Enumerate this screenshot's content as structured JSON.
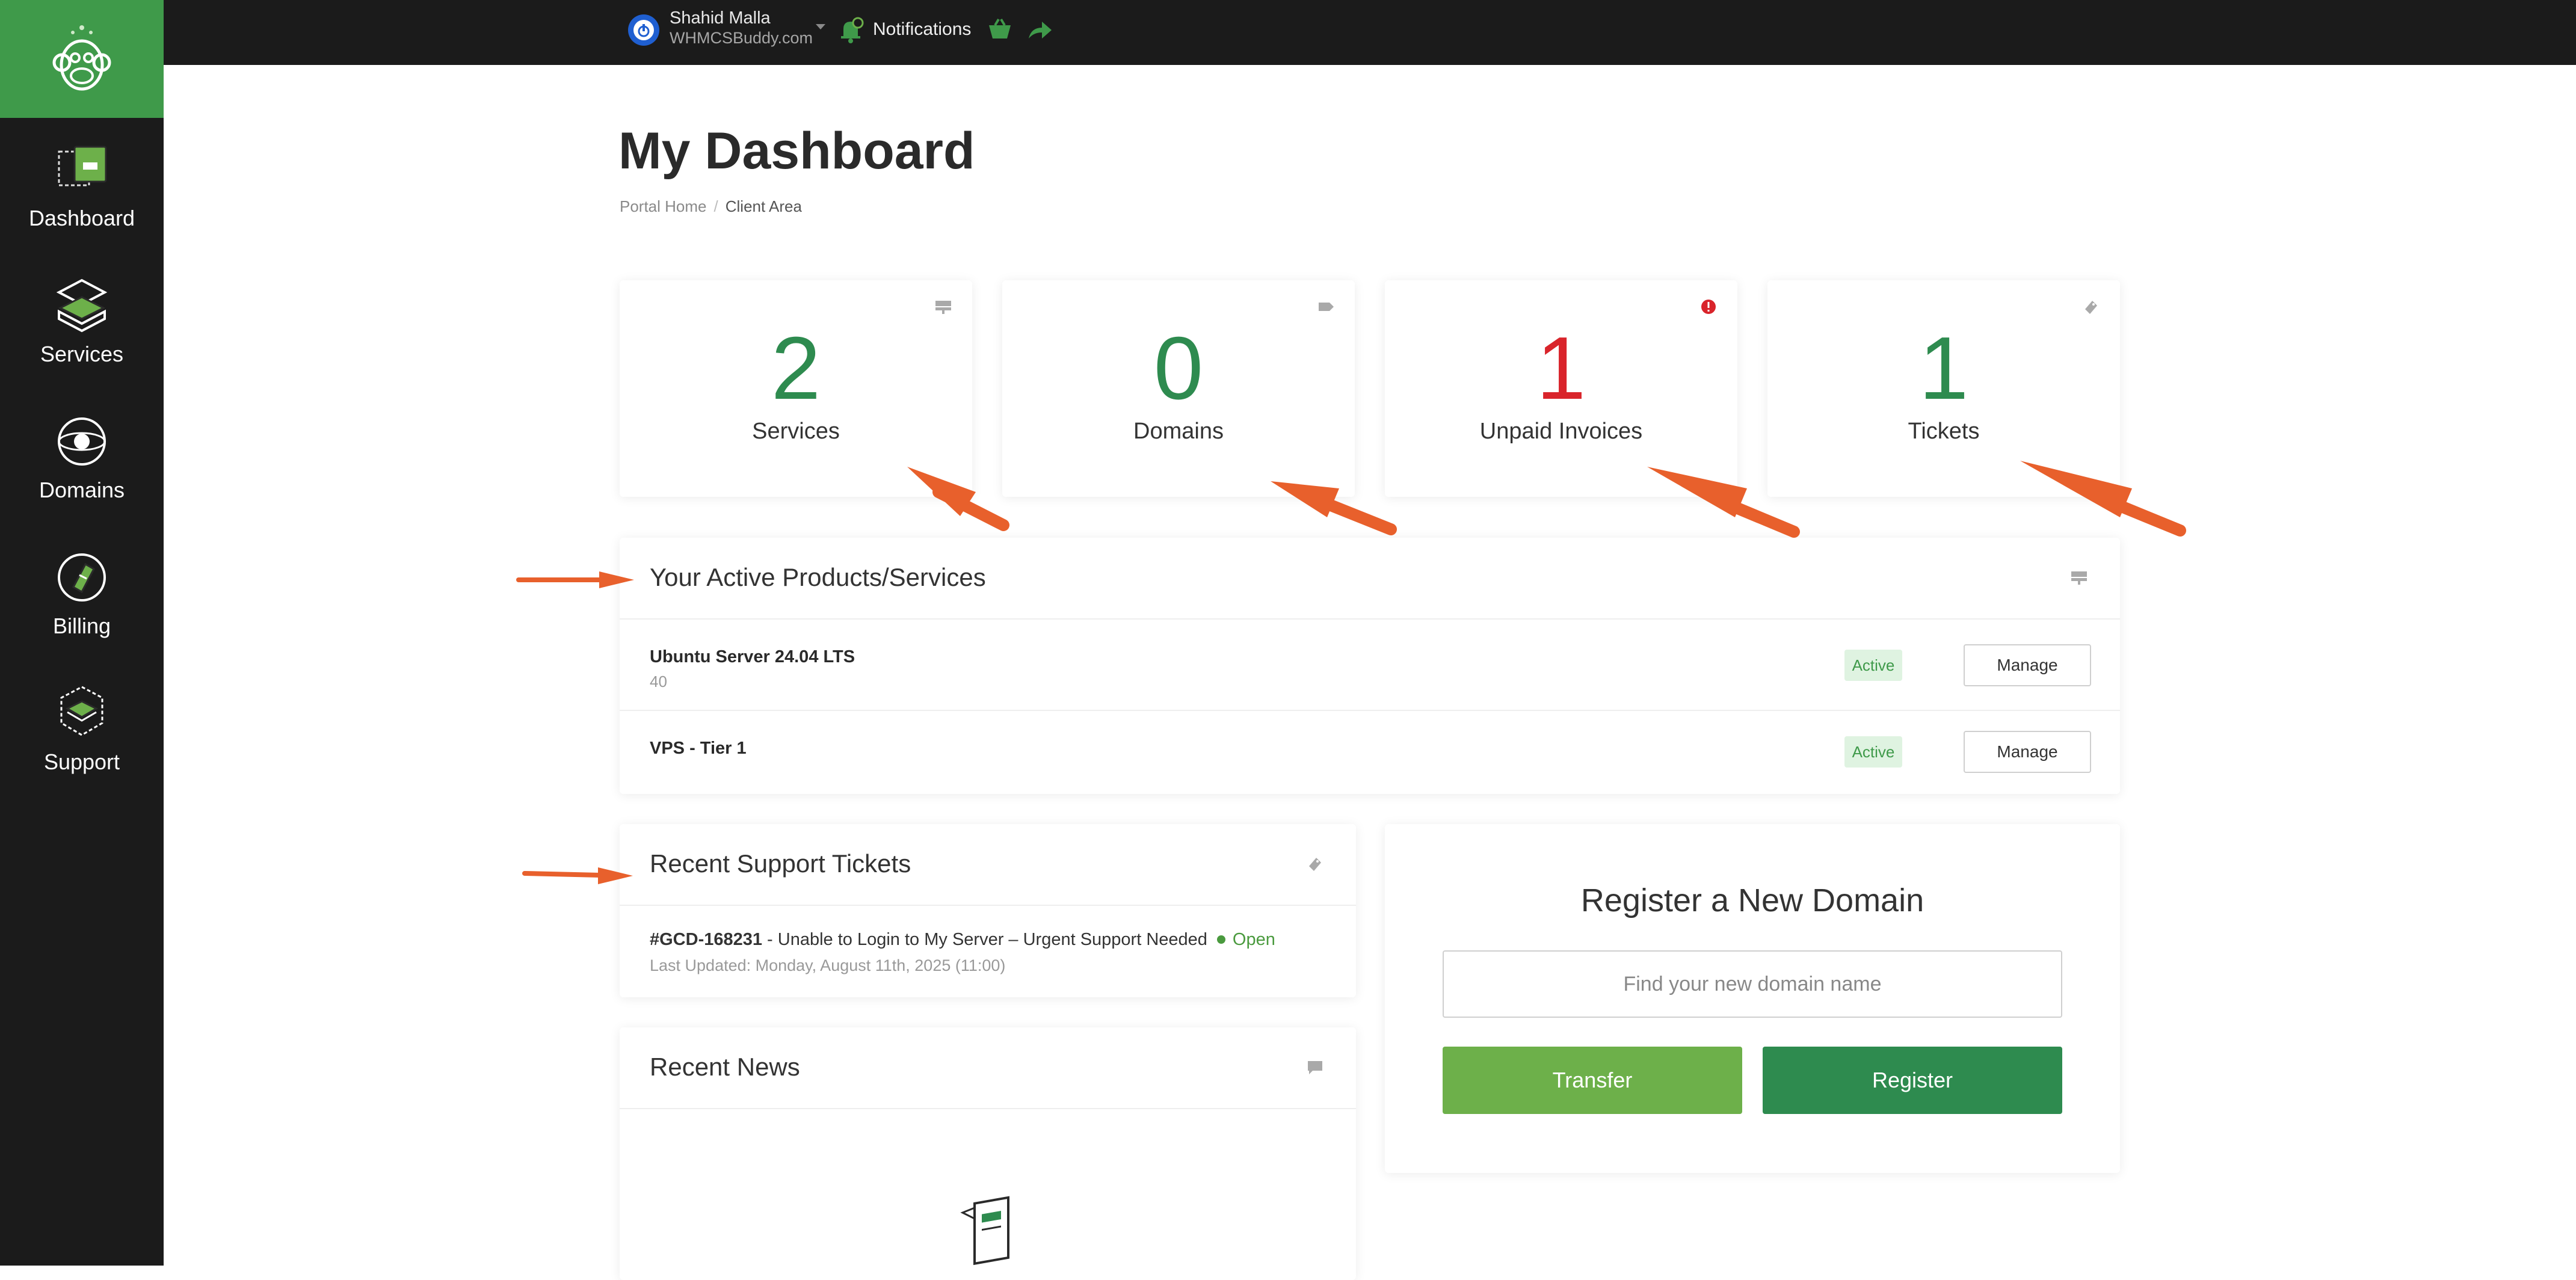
{
  "colors": {
    "accent_green": "#2e8b4f",
    "light_green": "#6db04a",
    "danger_red": "#d9242b",
    "sidebar_bg": "#1b1b1b",
    "annotation_orange": "#e8602c"
  },
  "sidebar": {
    "logo_icon": "monkey-logo-icon",
    "items": [
      {
        "label": "Dashboard",
        "icon": "dashboard-icon"
      },
      {
        "label": "Services",
        "icon": "services-icon"
      },
      {
        "label": "Domains",
        "icon": "domains-icon"
      },
      {
        "label": "Billing",
        "icon": "billing-icon"
      },
      {
        "label": "Support",
        "icon": "support-icon"
      }
    ]
  },
  "topbar": {
    "user_name": "Shahid Malla",
    "user_company": "WHMCSBuddy.com",
    "notifications_label": "Notifications"
  },
  "header": {
    "title": "My Dashboard",
    "breadcrumb": [
      "Portal Home",
      "Client Area"
    ]
  },
  "stats": [
    {
      "value": "2",
      "label": "Services",
      "icon": "server-icon",
      "color": "#2e8b4f"
    },
    {
      "value": "0",
      "label": "Domains",
      "icon": "tag-icon",
      "color": "#2e8b4f"
    },
    {
      "value": "1",
      "label": "Unpaid Invoices",
      "icon": "alert-icon",
      "color": "#d9242b"
    },
    {
      "value": "1",
      "label": "Tickets",
      "icon": "ticket-icon",
      "color": "#2e8b4f"
    }
  ],
  "services_panel": {
    "title": "Your Active Products/Services",
    "rows": [
      {
        "name": "Ubuntu Server 24.04 LTS",
        "sub": "40",
        "status": "Active",
        "action": "Manage"
      },
      {
        "name": "VPS - Tier 1",
        "sub": "",
        "status": "Active",
        "action": "Manage"
      }
    ]
  },
  "tickets_panel": {
    "title": "Recent Support Tickets",
    "ticket_id": "#GCD-168231",
    "ticket_subject": " - Unable to Login to My Server – Urgent Support Needed",
    "ticket_status": "Open",
    "ticket_updated": "Last Updated: Monday, August 11th, 2025 (11:00)"
  },
  "news_panel": {
    "title": "Recent News"
  },
  "domain_panel": {
    "title": "Register a New Domain",
    "placeholder": "Find your new domain name",
    "transfer_label": "Transfer",
    "register_label": "Register"
  }
}
